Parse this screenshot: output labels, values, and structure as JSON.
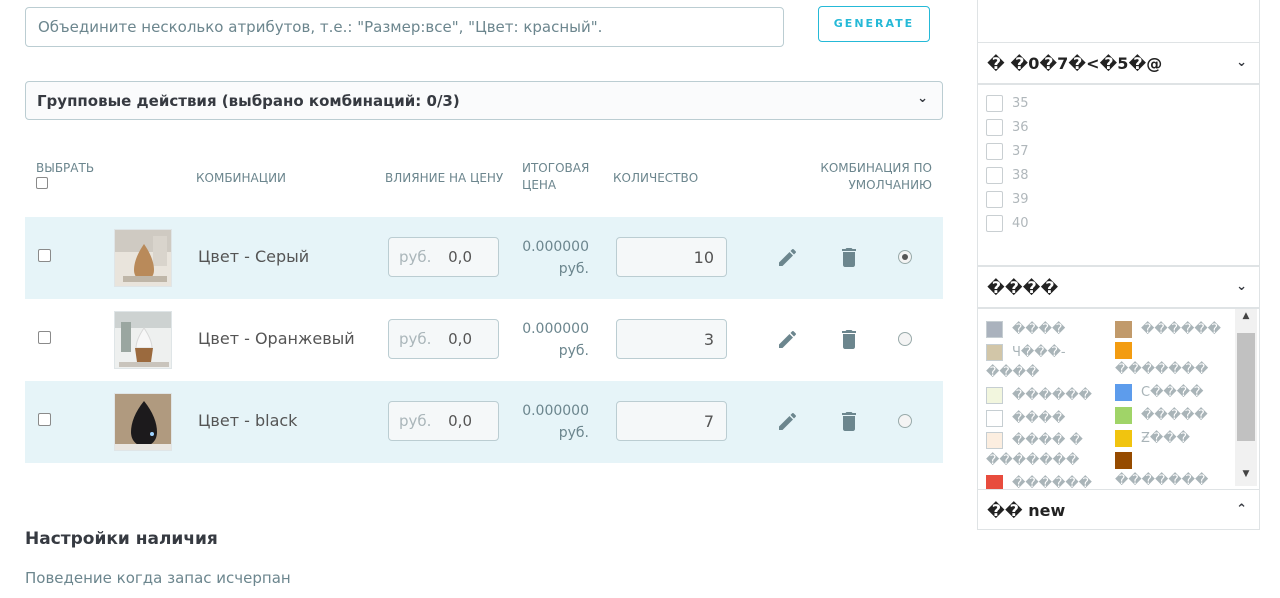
{
  "generator": {
    "placeholder": "Объедините несколько атрибутов, т.е.: \"Размер:все\", \"Цвет: красный\".",
    "button": "GENERATE"
  },
  "bulk_actions": {
    "label": "Групповые действия (выбрано комбинаций: 0/3)"
  },
  "table": {
    "headers": {
      "select": "ВЫБРАТЬ",
      "combinations": "КОМБИНАЦИИ",
      "price_impact": "ВЛИЯНИЕ НА ЦЕНУ",
      "final_price": "ИТОГОВАЯ ЦЕНА",
      "quantity": "КОЛИЧЕСТВО",
      "default": "КОМБИНАЦИЯ ПО УМОЛЧАНИЮ"
    },
    "rows": [
      {
        "name": "Цвет - Серый",
        "impact_currency": "руб.",
        "impact_value": "0,0",
        "final_price": "0.000000",
        "final_currency": "руб.",
        "quantity": "10",
        "is_default": true,
        "highlighted": true
      },
      {
        "name": "Цвет - Оранжевый",
        "impact_currency": "руб.",
        "impact_value": "0,0",
        "final_price": "0.000000",
        "final_currency": "руб.",
        "quantity": "3",
        "is_default": false,
        "highlighted": false
      },
      {
        "name": "Цвет - black",
        "impact_currency": "руб.",
        "impact_value": "0,0",
        "final_price": "0.000000",
        "final_currency": "руб.",
        "quantity": "7",
        "is_default": false,
        "highlighted": true
      }
    ]
  },
  "stock": {
    "title": "Настройки наличия",
    "subtitle": "Поведение когда запас исчерпан"
  },
  "sidebar": {
    "size_header": "� �0�7�<�5�@",
    "sizes": [
      "35",
      "36",
      "37",
      "38",
      "39",
      "40"
    ],
    "color_header": "����",
    "colors_left": [
      {
        "label": "����",
        "hex": "#aab2bd"
      },
      {
        "label": "Ч���-",
        "hex": "#d2c6a8"
      },
      {
        "label": "����",
        "hex": ""
      },
      {
        "label": "������",
        "hex": "#f2f6de"
      },
      {
        "label": "����",
        "hex": "#ffffff"
      },
      {
        "label": "���� �",
        "hex": "#fceee0"
      },
      {
        "label": "�������",
        "hex": ""
      },
      {
        "label": "������",
        "hex": "#e84c3d"
      }
    ],
    "colors_right": [
      {
        "label": "������",
        "hex": "#c19a6b"
      },
      {
        "label": "",
        "hex": "#f39c11"
      },
      {
        "label": "�������",
        "hex": ""
      },
      {
        "label": "С����",
        "hex": "#5d9cec"
      },
      {
        "label": "�����",
        "hex": "#a0d468"
      },
      {
        "label": "Ƶ���",
        "hex": "#f1c40f"
      },
      {
        "label": "",
        "hex": "#964b00"
      },
      {
        "label": "�������",
        "hex": ""
      }
    ],
    "new_header": "�� new"
  }
}
